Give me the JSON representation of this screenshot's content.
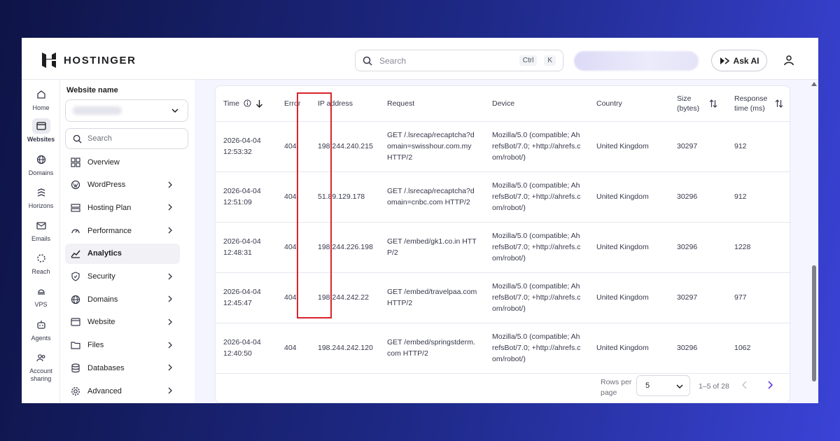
{
  "brand": {
    "name": "HOSTINGER"
  },
  "topbar": {
    "search_placeholder": "Search",
    "shortcut_ctrl": "Ctrl",
    "shortcut_key": "K",
    "ask_ai_label": "Ask AI"
  },
  "rail": [
    {
      "label": "Home",
      "icon": "home-icon"
    },
    {
      "label": "Websites",
      "icon": "websites-icon",
      "active": true
    },
    {
      "label": "Domains",
      "icon": "globe-icon"
    },
    {
      "label": "Horizons",
      "icon": "horizons-icon"
    },
    {
      "label": "Emails",
      "icon": "mail-icon"
    },
    {
      "label": "Reach",
      "icon": "reach-icon"
    },
    {
      "label": "VPS",
      "icon": "vps-icon"
    },
    {
      "label": "Agents",
      "icon": "agents-icon"
    },
    {
      "label": "Account sharing",
      "icon": "account-sharing-icon"
    }
  ],
  "sidebar": {
    "website_label": "Website name",
    "search_placeholder": "Search",
    "items": [
      {
        "label": "Overview",
        "icon": "overview-icon"
      },
      {
        "label": "WordPress",
        "icon": "wordpress-icon"
      },
      {
        "label": "Hosting Plan",
        "icon": "hosting-plan-icon"
      },
      {
        "label": "Performance",
        "icon": "performance-icon"
      },
      {
        "label": "Analytics",
        "icon": "analytics-icon",
        "active": true
      },
      {
        "label": "Security",
        "icon": "shield-icon"
      },
      {
        "label": "Domains",
        "icon": "globe-icon"
      },
      {
        "label": "Website",
        "icon": "website-icon"
      },
      {
        "label": "Files",
        "icon": "folder-icon"
      },
      {
        "label": "Databases",
        "icon": "database-icon"
      },
      {
        "label": "Advanced",
        "icon": "gear-icon"
      }
    ]
  },
  "table": {
    "headers": {
      "time": "Time",
      "error": "Error",
      "ip": "IP address",
      "request": "Request",
      "device": "Device",
      "country": "Country",
      "size": "Size (bytes)",
      "response": "Response time (ms)"
    },
    "rows": [
      {
        "time": "2026-04-04 12:53:32",
        "error": "404",
        "ip": "198.244.240.215",
        "request": "GET /.lsrecap/recaptcha?domain=swisshour.com.my HTTP/2",
        "device": "Mozilla/5.0 (compatible; AhrefsBot/7.0; +http://ahrefs.com/robot/)",
        "country": "United Kingdom",
        "size": "30297",
        "response": "912"
      },
      {
        "time": "2026-04-04 12:51:09",
        "error": "404",
        "ip": "51.89.129.178",
        "request": "GET /.lsrecap/recaptcha?domain=cnbc.com HTTP/2",
        "device": "Mozilla/5.0 (compatible; AhrefsBot/7.0; +http://ahrefs.com/robot/)",
        "country": "United Kingdom",
        "size": "30296",
        "response": "912"
      },
      {
        "time": "2026-04-04 12:48:31",
        "error": "404",
        "ip": "198.244.226.198",
        "request": "GET /embed/gk1.co.in HTTP/2",
        "device": "Mozilla/5.0 (compatible; AhrefsBot/7.0; +http://ahrefs.com/robot/)",
        "country": "United Kingdom",
        "size": "30296",
        "response": "1228"
      },
      {
        "time": "2026-04-04 12:45:47",
        "error": "404",
        "ip": "198.244.242.22",
        "request": "GET /embed/travelpaa.com HTTP/2",
        "device": "Mozilla/5.0 (compatible; AhrefsBot/7.0; +http://ahrefs.com/robot/)",
        "country": "United Kingdom",
        "size": "30297",
        "response": "977"
      },
      {
        "time": "2026-04-04 12:40:50",
        "error": "404",
        "ip": "198.244.242.120",
        "request": "GET /embed/springstderm.com HTTP/2",
        "device": "Mozilla/5.0 (compatible; AhrefsBot/7.0; +http://ahrefs.com/robot/)",
        "country": "United Kingdom",
        "size": "30296",
        "response": "1062"
      }
    ]
  },
  "pagination": {
    "rows_label": "Rows per page",
    "rows_value": "5",
    "range": "1–5 of 28"
  },
  "colors": {
    "highlight": "#d9232d",
    "brand": "#673de6"
  }
}
